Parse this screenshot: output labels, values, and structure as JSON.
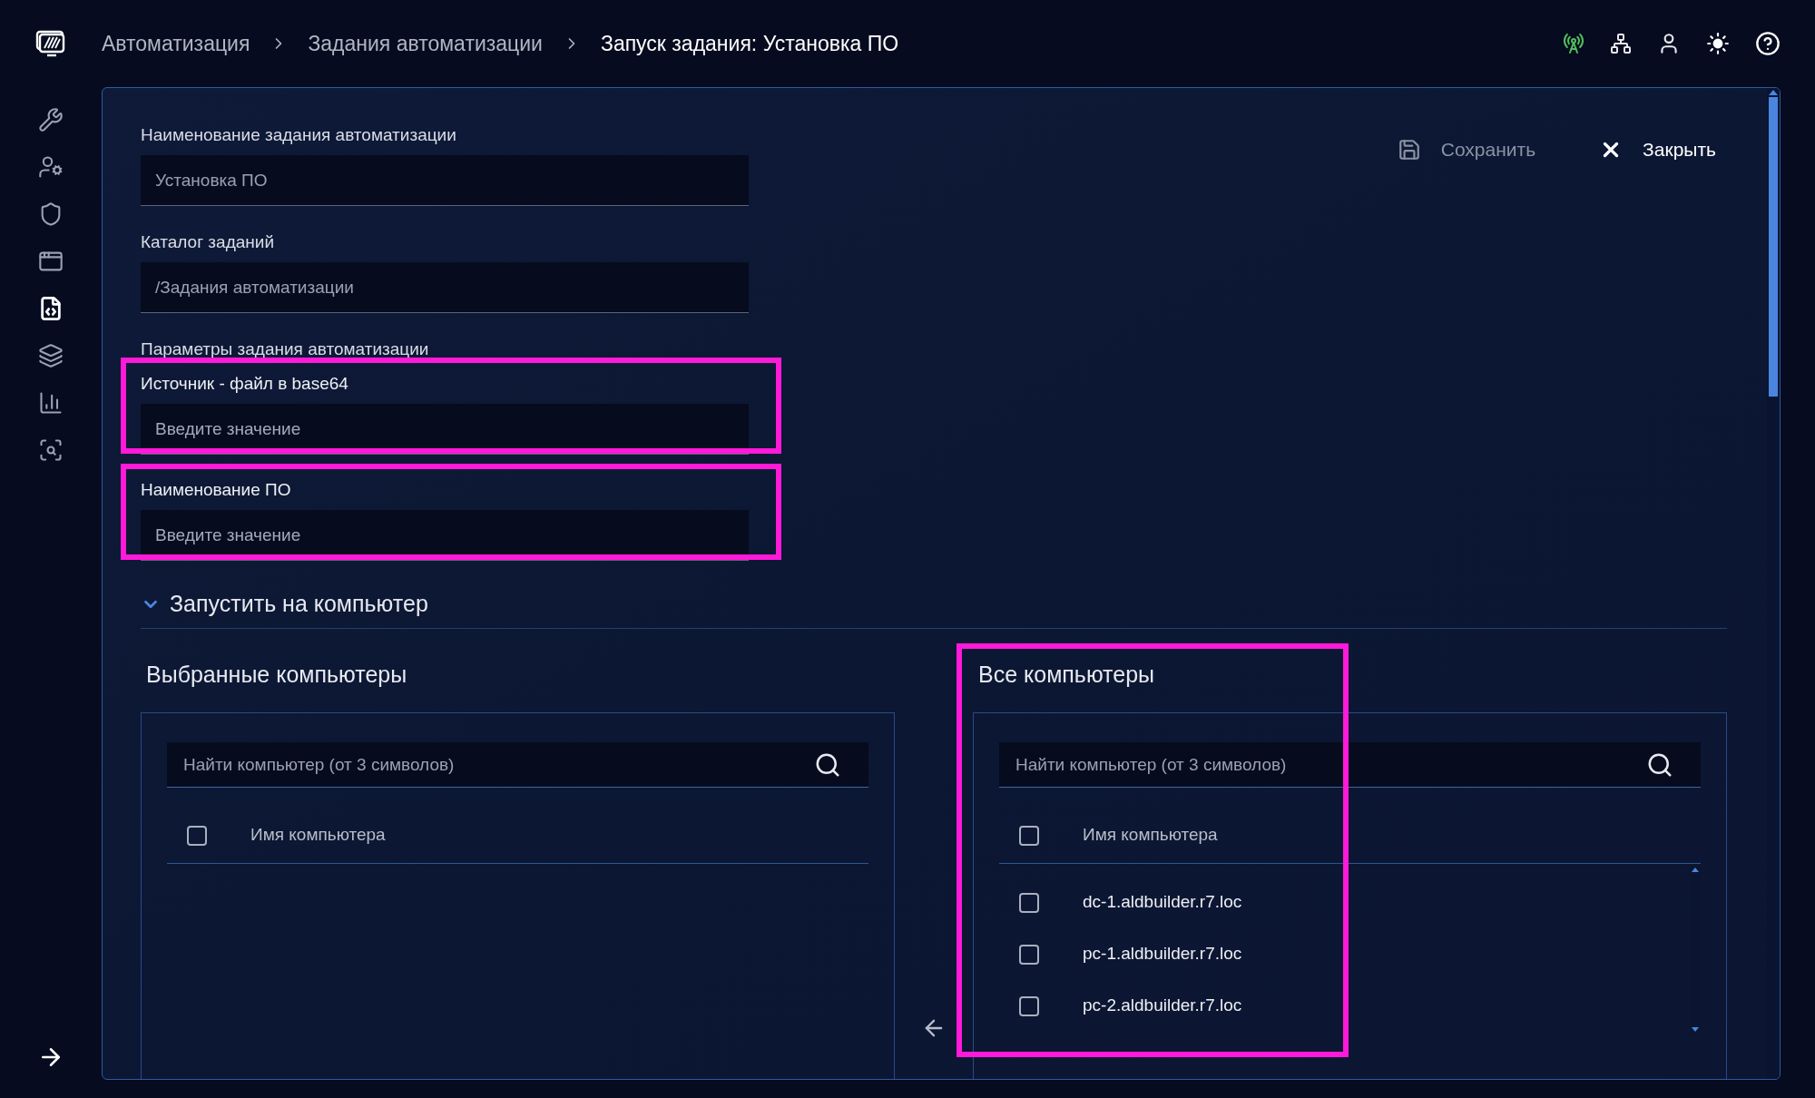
{
  "breadcrumbs": [
    {
      "label": "Автоматизация",
      "current": false
    },
    {
      "label": "Задания автоматизации",
      "current": false
    },
    {
      "label": "Запуск задания: Установка ПО",
      "current": true
    }
  ],
  "sidebar": {
    "items": [
      {
        "kind": "tools",
        "selected": false
      },
      {
        "kind": "user-settings",
        "selected": false
      },
      {
        "kind": "shield",
        "selected": false
      },
      {
        "kind": "window",
        "selected": false
      },
      {
        "kind": "code-file",
        "selected": true
      },
      {
        "kind": "layers",
        "selected": false
      },
      {
        "kind": "chart",
        "selected": false
      },
      {
        "kind": "search",
        "selected": false
      }
    ]
  },
  "actions": [
    {
      "kind": "save",
      "label": "Сохранить",
      "disabled": true
    },
    {
      "kind": "close",
      "label": "Закрыть",
      "disabled": false
    }
  ],
  "fields": [
    {
      "label": "Наименование задания автоматизации",
      "value": "Установка ПО",
      "disabled": true
    },
    {
      "label": "Каталог заданий",
      "value": "/Задания автоматизации",
      "disabled": true
    }
  ],
  "params_title": "Параметры задания автоматизации",
  "params": [
    {
      "label": "Источник - файл в base64",
      "placeholder": "Введите значение",
      "highlighted": true
    },
    {
      "label": "Наименование ПО",
      "placeholder": "Введите значение",
      "highlighted": true
    }
  ],
  "section": {
    "title": "Запустить на компьютер",
    "expanded": true,
    "selected_panel": {
      "title": "Выбранные компьютеры",
      "search_placeholder": "Найти компьютер (от 3 символов)",
      "column": "Имя компьютера",
      "all_checked": false
    },
    "all_panel": {
      "title": "Все компьютеры",
      "search_placeholder": "Найти компьютер (от 3 символов)",
      "column": "Имя компьютера",
      "all_checked": false,
      "highlighted": true,
      "rows": [
        {
          "name": "dc-1.aldbuilder.r7.loc",
          "checked": false
        },
        {
          "name": "pc-1.aldbuilder.r7.loc",
          "checked": false
        },
        {
          "name": "pc-2.aldbuilder.r7.loc",
          "checked": false
        }
      ]
    }
  }
}
